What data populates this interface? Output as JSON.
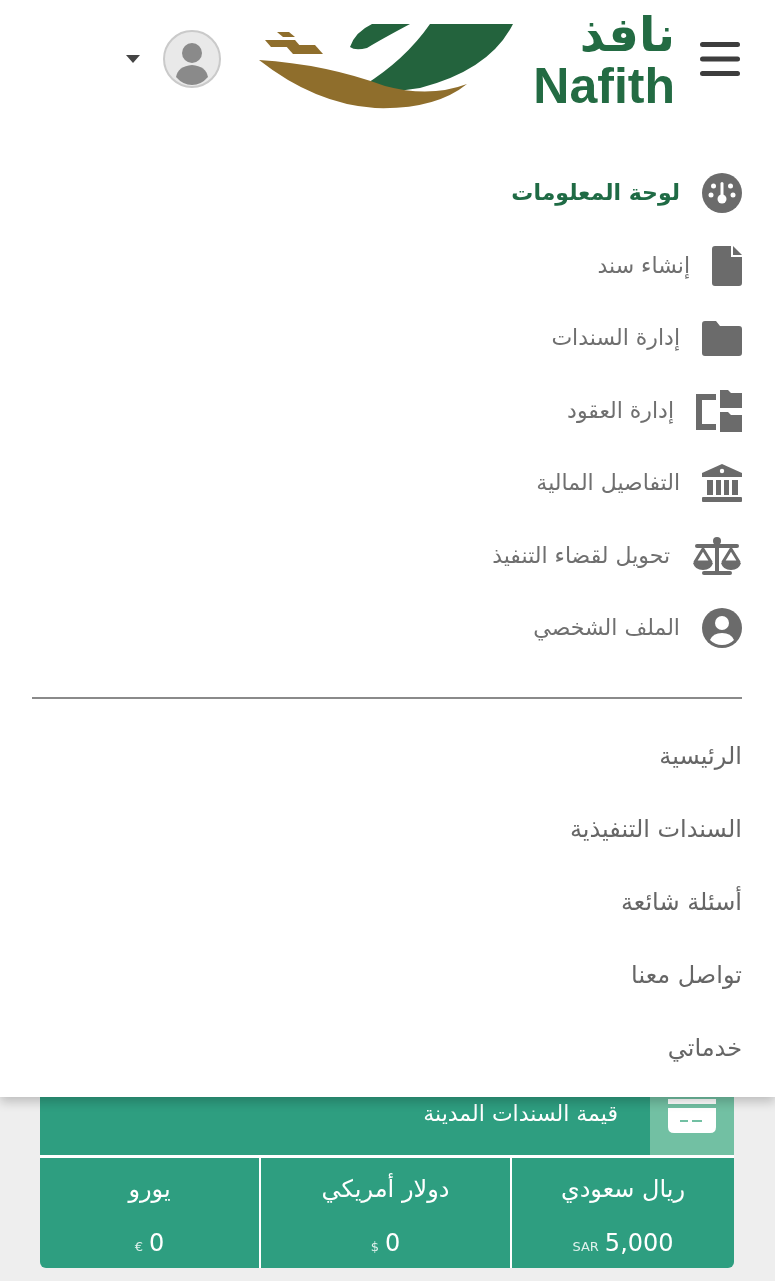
{
  "header": {
    "logo": {
      "arabic": "نافذ",
      "latin": "Nafith"
    }
  },
  "sidebar": {
    "items": [
      {
        "label": "لوحة المعلومات",
        "selected": true
      },
      {
        "label": "إنشاء سند",
        "selected": false
      },
      {
        "label": "إدارة السندات",
        "selected": false
      },
      {
        "label": "إدارة العقود",
        "selected": false
      },
      {
        "label": "التفاصيل المالية",
        "selected": false
      },
      {
        "label": "تحويل لقضاء التنفيذ",
        "selected": false
      },
      {
        "label": "الملف الشخصي",
        "selected": false
      }
    ]
  },
  "nav_links": [
    "الرئيسية",
    "السندات التنفيذية",
    "أسئلة شائعة",
    "تواصل معنا",
    "خدماتي"
  ],
  "summary_card": {
    "title": "قيمة السندات المدينة",
    "currencies": [
      {
        "name": "ريال سعودي",
        "amount": "5,000",
        "unit": "SAR"
      },
      {
        "name": "دولار أمريكي",
        "amount": "0",
        "unit": "$"
      },
      {
        "name": "يورو",
        "amount": "0",
        "unit": "€"
      }
    ]
  }
}
